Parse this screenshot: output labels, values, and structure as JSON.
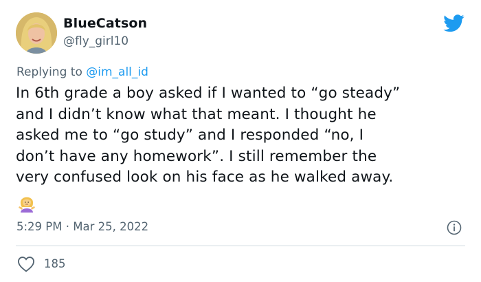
{
  "tweet": {
    "display_name": "BlueCatson",
    "handle": "@fly_girl10",
    "replying_prefix": "Replying to ",
    "replying_to": "@im_all_id",
    "text": "In 6th grade a boy asked if I wanted to “go steady”\nand I didn’t know what that meant. I thought he\nasked me to “go study” and I responded “no, I\ndon’t have any homework”. I still remember the\nvery confused look on his face as he walked away.",
    "emoji": "person-shrugging-emoji",
    "timestamp": "5:29 PM · Mar 25, 2022",
    "like_count": "185"
  },
  "colors": {
    "text": "#0f1419",
    "muted": "#536471",
    "accent": "#1d9bf0",
    "divider": "#cfd9de"
  },
  "icons": [
    "twitter-bird-icon",
    "info-icon",
    "heart-icon"
  ]
}
